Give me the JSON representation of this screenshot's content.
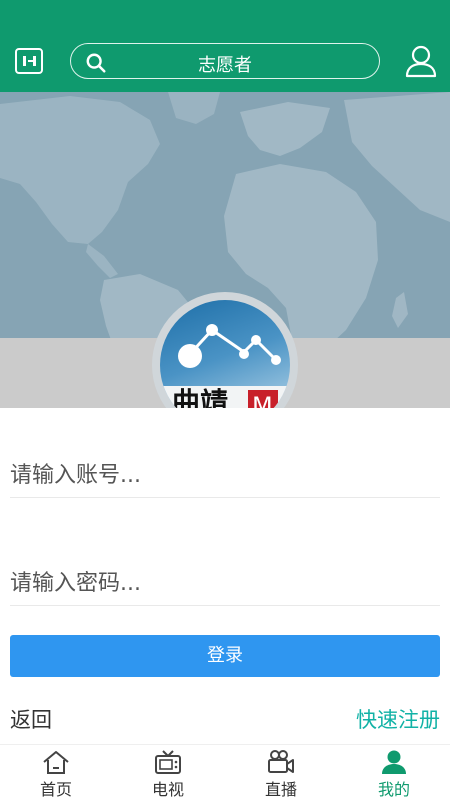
{
  "header": {
    "search_text": "志愿者",
    "colors": {
      "header_bg": "#0f9a6e"
    },
    "icons": {
      "left": "menu-square-icon",
      "search": "search-icon",
      "right": "user-icon"
    }
  },
  "banner": {
    "logo": {
      "text": "曲靖",
      "badge": "M"
    }
  },
  "form": {
    "account_placeholder": "请输入账号...",
    "password_placeholder": "请输入密码...",
    "login_label": "登录",
    "back_label": "返回",
    "register_label": "快速注册",
    "colors": {
      "login_button": "#2f96f0",
      "register_link": "#11b2a6"
    }
  },
  "bottom_nav": {
    "items": [
      {
        "label": "首页",
        "icon": "home-icon",
        "active": false
      },
      {
        "label": "电视",
        "icon": "tv-icon",
        "active": false
      },
      {
        "label": "直播",
        "icon": "camera-icon",
        "active": false
      },
      {
        "label": "我的",
        "icon": "profile-icon",
        "active": true
      }
    ],
    "colors": {
      "active": "#0f9a6e"
    }
  }
}
